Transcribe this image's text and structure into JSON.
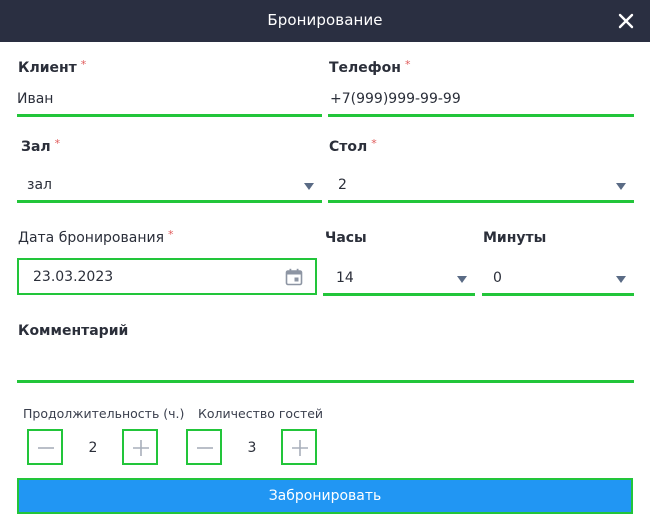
{
  "dialog": {
    "title": "Бронирование"
  },
  "client": {
    "label": "Клиент",
    "required": "*",
    "value": "Иван"
  },
  "phone": {
    "label": "Телефон",
    "required": "*",
    "value": "+7(999)999-99-99"
  },
  "hall": {
    "label": "Зал",
    "required": "*",
    "value": "зал"
  },
  "table": {
    "label": "Стол",
    "required": "*",
    "value": "2"
  },
  "date": {
    "label": "Дата бронирования",
    "required": "*",
    "value": "23.03.2023"
  },
  "hours": {
    "label": "Часы",
    "value": "14"
  },
  "minutes": {
    "label": "Минуты",
    "value": "0"
  },
  "comment": {
    "label": "Комментарий",
    "value": ""
  },
  "duration": {
    "label": "Продолжительность (ч.)",
    "value": "2"
  },
  "guests": {
    "label": "Количество гостей",
    "value": "3"
  },
  "submit": {
    "label": "Забронировать"
  },
  "colors": {
    "header": "#2a2f41",
    "accent_border": "#22c53a",
    "primary_button": "#2196f3",
    "required": "#e05a5a"
  },
  "icons": {
    "close": "close-icon",
    "calendar": "calendar-icon",
    "dropdown": "chevron-down-icon",
    "minus": "minus-icon",
    "plus": "plus-icon"
  }
}
